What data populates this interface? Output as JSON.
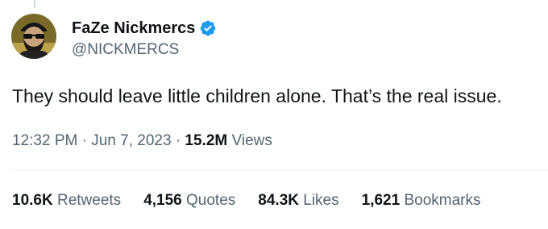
{
  "author": {
    "display_name": "FaZe Nickmercs",
    "handle": "@NICKMERCS",
    "verified": true,
    "verified_color": "#1d9bf0",
    "avatar_icon": "bearded-man-sunglasses-avatar"
  },
  "tweet": {
    "text": "They should leave little children alone. That’s the real issue.",
    "time": "12:32 PM",
    "separator": "·",
    "date": "Jun 7, 2023",
    "views_count": "15.2M",
    "views_label": "Views"
  },
  "stats": [
    {
      "count": "10.6K",
      "label": "Retweets"
    },
    {
      "count": "4,156",
      "label": "Quotes"
    },
    {
      "count": "84.3K",
      "label": "Likes"
    },
    {
      "count": "1,621",
      "label": "Bookmarks"
    }
  ],
  "colors": {
    "text_primary": "#0f1419",
    "text_secondary": "#536471",
    "divider": "#eff3f4",
    "accent": "#1d9bf0"
  }
}
